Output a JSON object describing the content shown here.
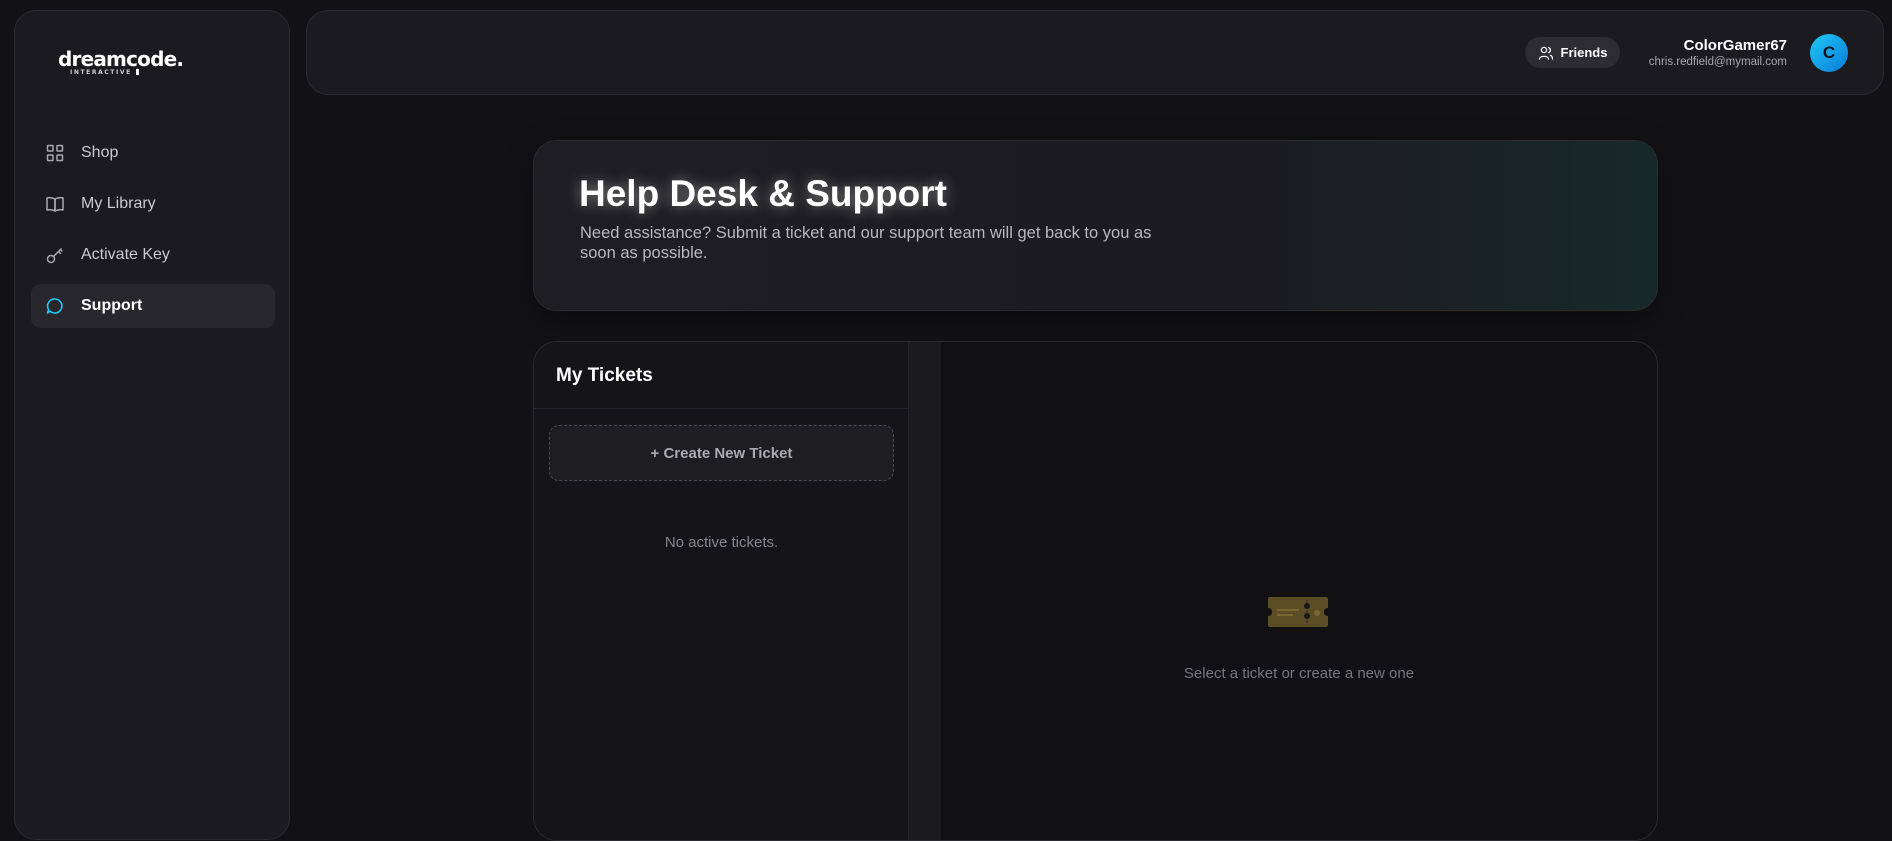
{
  "brand": {
    "name": "dreamcode.",
    "tagline": "INTERACTIVE"
  },
  "sidebar": {
    "items": [
      {
        "label": "Shop",
        "icon": "grid-icon",
        "active": false
      },
      {
        "label": "My Library",
        "icon": "book-icon",
        "active": false
      },
      {
        "label": "Activate Key",
        "icon": "key-icon",
        "active": false
      },
      {
        "label": "Support",
        "icon": "chat-bubble-icon",
        "active": true
      }
    ]
  },
  "topbar": {
    "friends_label": "Friends",
    "user": {
      "name": "ColorGamer67",
      "email": "chris.redfield@mymail.com",
      "avatar_letter": "C"
    }
  },
  "hero": {
    "title": "Help Desk & Support",
    "description": "Need assistance? Submit a ticket and our support team will get back to you as soon as possible."
  },
  "tickets": {
    "title": "My Tickets",
    "create_label": "+ Create New Ticket",
    "empty_list": "No active tickets.",
    "empty_detail": "Select a ticket or create a new one"
  },
  "colors": {
    "accent": "#1fc8f5",
    "background": "#121214",
    "panel": "#1b1b1f",
    "ticket_icon": "#6b5a2a"
  }
}
